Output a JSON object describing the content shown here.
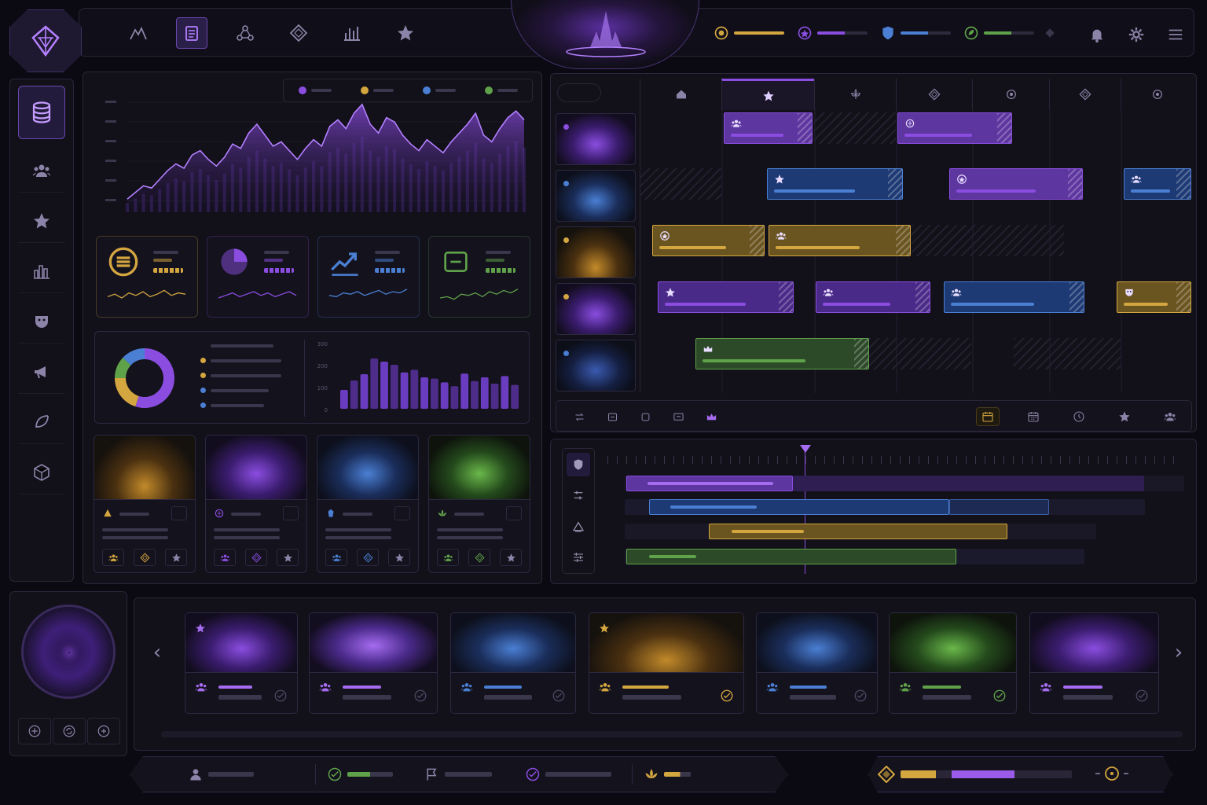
{
  "colors": {
    "bg": "#0b0a13",
    "panel": "#121019",
    "purple": "#8a4de0",
    "gold": "#d4a640",
    "blue": "#4a7fd4",
    "green": "#5fa24a",
    "accent": "#a56cf0"
  },
  "top_nav": {
    "logo": "diamond-crown-logo",
    "items": [
      {
        "name": "mountain-chart-icon",
        "active": false
      },
      {
        "name": "clipboard-icon",
        "active": true
      },
      {
        "name": "network-icon",
        "active": false
      },
      {
        "name": "diamond-icon",
        "active": false
      },
      {
        "name": "bar-chart-icon",
        "active": false
      },
      {
        "name": "star-icon",
        "active": false
      }
    ],
    "status_chips": [
      {
        "icon": "coin-icon",
        "color": "#d4a640",
        "fill": 1.0
      },
      {
        "icon": "badge-icon",
        "color": "#8a4de0",
        "fill": 0.55
      },
      {
        "icon": "shield-icon",
        "color": "#4a7fd4",
        "fill": 0.55
      },
      {
        "icon": "leaf-icon",
        "color": "#5fa24a",
        "fill": 0.55
      }
    ],
    "right_icons": [
      "bell-icon",
      "gear-icon",
      "menu-icon"
    ]
  },
  "sidebar": {
    "items": [
      {
        "name": "database-icon",
        "active": true
      },
      {
        "name": "users-icon",
        "active": false
      },
      {
        "name": "star-icon",
        "active": false
      },
      {
        "name": "city-chart-icon",
        "active": false
      },
      {
        "name": "mask-icon",
        "active": false
      },
      {
        "name": "megaphone-icon",
        "active": false
      },
      {
        "name": "feather-icon",
        "active": false
      },
      {
        "name": "cube-icon",
        "active": false
      }
    ]
  },
  "main_chart": {
    "legend": [
      {
        "color": "#8a4de0"
      },
      {
        "color": "#d4a640"
      },
      {
        "color": "#4a7fd4"
      },
      {
        "color": "#5fa24a"
      }
    ],
    "values": [
      12,
      18,
      24,
      22,
      30,
      38,
      44,
      40,
      52,
      56,
      48,
      42,
      50,
      62,
      58,
      72,
      80,
      70,
      60,
      64,
      56,
      48,
      58,
      66,
      60,
      78,
      84,
      76,
      90,
      98,
      80,
      72,
      86,
      82,
      70,
      62,
      56,
      66,
      60,
      54,
      64,
      72,
      80,
      90,
      70,
      64,
      76,
      86,
      92,
      84
    ]
  },
  "kpis": [
    {
      "icon": "coins-icon",
      "color": "#d4a640",
      "spark": [
        6,
        8,
        5,
        9,
        7,
        10,
        6,
        8,
        11,
        7,
        9,
        8
      ]
    },
    {
      "icon": "pie-icon",
      "color": "#8a4de0",
      "spark": [
        5,
        7,
        9,
        6,
        8,
        10,
        7,
        9,
        6,
        8,
        10,
        7
      ]
    },
    {
      "icon": "trend-icon",
      "color": "#4a7fd4",
      "spark": [
        7,
        6,
        9,
        8,
        10,
        7,
        9,
        11,
        8,
        10,
        9,
        12
      ]
    },
    {
      "icon": "box-icon",
      "color": "#5fa24a",
      "spark": [
        5,
        6,
        4,
        8,
        7,
        9,
        6,
        10,
        8,
        11,
        9,
        12
      ]
    }
  ],
  "donut": {
    "slices": [
      {
        "color": "#8a4de0",
        "value": 55
      },
      {
        "color": "#d4a640",
        "value": 20
      },
      {
        "color": "#5fa24a",
        "value": 12
      },
      {
        "color": "#4a7fd4",
        "value": 13
      }
    ],
    "legend_colors": [
      "#8a4de0",
      "#d4a640",
      "#d4a640",
      "#4a7fd4",
      "#4a7fd4"
    ]
  },
  "bar_panel": {
    "ticks": [
      "300",
      "200",
      "100",
      "0"
    ],
    "values": [
      30,
      45,
      55,
      80,
      75,
      70,
      58,
      62,
      50,
      48,
      42,
      36,
      56,
      44,
      50,
      40,
      52,
      38
    ]
  },
  "event_cards": [
    {
      "theme": "gold",
      "icon": "candle-icon",
      "color": "#d4a640"
    },
    {
      "theme": "purple",
      "icon": "portal-icon",
      "color": "#8a4de0"
    },
    {
      "theme": "blue",
      "icon": "crystal-icon",
      "color": "#4a7fd4"
    },
    {
      "theme": "green",
      "icon": "lotus-icon",
      "color": "#5fa24a"
    }
  ],
  "schedule": {
    "columns": [
      "house-icon",
      "star-icon",
      "fleur-icon",
      "diamond-icon",
      "target-icon",
      "diamond-icon",
      "target-icon"
    ],
    "active_col": 1,
    "rows": [
      {
        "theme": "purple"
      },
      {
        "theme": "blue"
      },
      {
        "theme": "gold"
      },
      {
        "theme": "purple"
      },
      {
        "theme": "navy"
      }
    ]
  },
  "toolbar": {
    "left": [
      "transfer-icon",
      "box-icon",
      "square-icon",
      "screen-icon",
      "crown-icon"
    ],
    "right": [
      "calendar-icon",
      "calendar-grid-icon",
      "clock-icon",
      "star-icon",
      "users-icon"
    ]
  },
  "timeline": {
    "tools": [
      "shield-icon",
      "sliders-icon",
      "triangle-icon",
      "tune-icon"
    ]
  },
  "compass": {
    "buttons": [
      "plus-circle-icon",
      "refresh-icon",
      "add-icon"
    ]
  },
  "carousel": [
    {
      "theme": "purple",
      "star": true,
      "w": 144
    },
    {
      "theme": "violet",
      "star": false,
      "w": 164
    },
    {
      "theme": "blue",
      "star": false,
      "w": 160
    },
    {
      "theme": "gold",
      "star": true,
      "w": 198
    },
    {
      "theme": "blue",
      "star": false,
      "w": 155
    },
    {
      "theme": "green",
      "star": false,
      "w": 163
    },
    {
      "theme": "purple",
      "star": false,
      "w": 165
    }
  ],
  "bottom_bar": {
    "items": [
      {
        "icon": "user-icon",
        "color": "#8c84a8"
      },
      {
        "icon": "check-circle-icon",
        "color": "#5fa24a"
      },
      {
        "icon": "flag-icon",
        "color": "#8c84a8"
      },
      {
        "icon": "check-circle-icon",
        "color": "#8a4de0"
      },
      {
        "icon": "lotus-icon",
        "color": "#d4a640"
      }
    ],
    "progress": {
      "gold": 0.33,
      "purple": 0.37
    }
  }
}
